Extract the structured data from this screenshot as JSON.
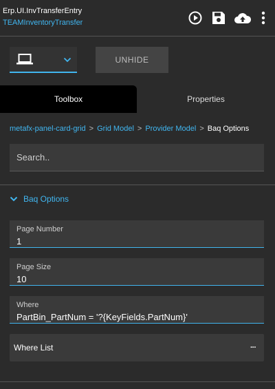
{
  "header": {
    "title": "Erp.UI.InvTransferEntry",
    "subtitle": "TEAMInventoryTransfer"
  },
  "toolbar": {
    "unhide_label": "UNHIDE",
    "device_icon": "laptop-icon"
  },
  "tabs": [
    {
      "label": "Toolbox",
      "active": true
    },
    {
      "label": "Properties",
      "active": false
    }
  ],
  "breadcrumb": {
    "items": [
      "metafx-panel-card-grid",
      "Grid Model",
      "Provider Model"
    ],
    "current": "Baq Options"
  },
  "search": {
    "placeholder": "Search.."
  },
  "section": {
    "label": "Baq Options"
  },
  "fields": [
    {
      "label": "Page Number",
      "value": "1"
    },
    {
      "label": "Page Size",
      "value": "10"
    },
    {
      "label": "Where",
      "value": "PartBin_PartNum = '?{KeyFields.PartNum}'"
    }
  ],
  "where_list": {
    "label": "Where List",
    "more": "···"
  },
  "colors": {
    "accent": "#41b6f0",
    "background": "#2b2b2b",
    "active_tab": "#000000"
  }
}
